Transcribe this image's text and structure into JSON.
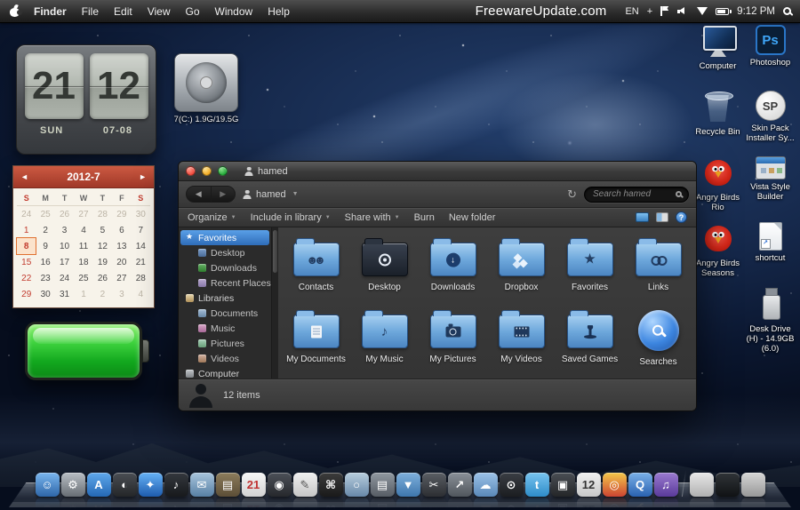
{
  "menubar": {
    "items": [
      "Finder",
      "File",
      "Edit",
      "View",
      "Go",
      "Window",
      "Help"
    ],
    "watermark": "FreewareUpdate.com",
    "lang": "EN",
    "plus": "+",
    "time": "9:12 PM"
  },
  "icons": {
    "back": "◀",
    "forward": "▶",
    "caret": "▼",
    "refresh": "↻",
    "help": "?",
    "prev": "◄",
    "next": "►",
    "apple": "apple-logo",
    "search": "magnifier",
    "wifi": "wifi",
    "volume": "speaker",
    "battery": "battery",
    "flag": "flag"
  },
  "widgets": {
    "flip_clock": {
      "hour": "21",
      "minute": "12",
      "weekday": "SUN",
      "date": "07-08"
    },
    "calendar": {
      "title": "2012-7",
      "day_headers": [
        "S",
        "M",
        "T",
        "W",
        "T",
        "F",
        "S"
      ],
      "weeks": [
        [
          {
            "d": "24",
            "m": 1
          },
          {
            "d": "25",
            "m": 1
          },
          {
            "d": "26",
            "m": 1
          },
          {
            "d": "27",
            "m": 1
          },
          {
            "d": "28",
            "m": 1
          },
          {
            "d": "29",
            "m": 1
          },
          {
            "d": "30",
            "m": 1
          }
        ],
        [
          {
            "d": "1",
            "r": 1
          },
          {
            "d": "2"
          },
          {
            "d": "3"
          },
          {
            "d": "4"
          },
          {
            "d": "5"
          },
          {
            "d": "6"
          },
          {
            "d": "7"
          }
        ],
        [
          {
            "d": "8",
            "r": 1,
            "s": 1
          },
          {
            "d": "9"
          },
          {
            "d": "10"
          },
          {
            "d": "11"
          },
          {
            "d": "12"
          },
          {
            "d": "13"
          },
          {
            "d": "14"
          }
        ],
        [
          {
            "d": "15",
            "r": 1
          },
          {
            "d": "16"
          },
          {
            "d": "17"
          },
          {
            "d": "18"
          },
          {
            "d": "19"
          },
          {
            "d": "20"
          },
          {
            "d": "21"
          }
        ],
        [
          {
            "d": "22",
            "r": 1
          },
          {
            "d": "23"
          },
          {
            "d": "24"
          },
          {
            "d": "25"
          },
          {
            "d": "26"
          },
          {
            "d": "27"
          },
          {
            "d": "28"
          }
        ],
        [
          {
            "d": "29",
            "r": 1
          },
          {
            "d": "30"
          },
          {
            "d": "31"
          },
          {
            "d": "1",
            "m": 1
          },
          {
            "d": "2",
            "m": 1
          },
          {
            "d": "3",
            "m": 1
          },
          {
            "d": "4",
            "m": 1
          }
        ]
      ]
    }
  },
  "desktop": {
    "drive": {
      "label": "7(C:) 1.9G/19.5G"
    },
    "right_icons": [
      {
        "label": "Computer",
        "icon": "computer"
      },
      {
        "label": "Photoshop",
        "icon": "photoshop",
        "glyph": "Ps"
      },
      {
        "label": "Recycle Bin",
        "icon": "recycle-bin"
      },
      {
        "label": "Skin Pack Installer Sy...",
        "icon": "skinpack",
        "glyph": "SP"
      },
      {
        "label": "Angry Birds Rio",
        "icon": "angry-bird"
      },
      {
        "label": "Vista Style Builder",
        "icon": "vsb"
      },
      {
        "label": "Angry Birds Seasons",
        "icon": "angry-bird"
      },
      {
        "label": "shortcut",
        "icon": "shortcut"
      },
      {
        "label": "Desk Drive (H) - 14.9GB (6.0)",
        "icon": "usb-drive",
        "col": 2
      }
    ]
  },
  "window": {
    "title": "hamed",
    "path": "hamed",
    "search_placeholder": "Search hamed",
    "commandbar": [
      {
        "label": "Organize",
        "dd": true
      },
      {
        "label": "Include in library",
        "dd": true
      },
      {
        "label": "Share with",
        "dd": true
      },
      {
        "label": "Burn"
      },
      {
        "label": "New folder"
      }
    ],
    "sidebar": {
      "sections": [
        {
          "label": "Favorites",
          "icon": "star",
          "selected": true,
          "items": [
            {
              "label": "Desktop",
              "icon": "desktop"
            },
            {
              "label": "Downloads",
              "icon": "downloads"
            },
            {
              "label": "Recent Places",
              "icon": "recent"
            }
          ]
        },
        {
          "label": "Libraries",
          "icon": "libraries",
          "items": [
            {
              "label": "Documents",
              "icon": "documents"
            },
            {
              "label": "Music",
              "icon": "music"
            },
            {
              "label": "Pictures",
              "icon": "pictures"
            },
            {
              "label": "Videos",
              "icon": "videos"
            }
          ]
        },
        {
          "label": "Computer",
          "icon": "computer",
          "items": []
        }
      ]
    },
    "folders": [
      {
        "label": "Contacts",
        "emblem": "contacts",
        "glyph": "☻☻"
      },
      {
        "label": "Desktop",
        "emblem": "desktop-logo",
        "variant": "dark"
      },
      {
        "label": "Downloads",
        "emblem": "downloads",
        "glyph": "↓"
      },
      {
        "label": "Dropbox",
        "emblem": "dropbox"
      },
      {
        "label": "Favorites",
        "emblem": "star",
        "glyph": "★"
      },
      {
        "label": "Links",
        "emblem": "links"
      },
      {
        "label": "My Documents",
        "emblem": "documents"
      },
      {
        "label": "My Music",
        "emblem": "music",
        "glyph": "♪"
      },
      {
        "label": "My Pictures",
        "emblem": "camera"
      },
      {
        "label": "My Videos",
        "emblem": "film"
      },
      {
        "label": "Saved Games",
        "emblem": "joystick"
      },
      {
        "label": "Searches",
        "emblem": "search",
        "variant": "sphere"
      }
    ],
    "status": "12 items"
  },
  "dock": {
    "icons": [
      {
        "name": "finder",
        "glyph": "☺",
        "c1": "#7ab6ef",
        "c2": "#2e66a8"
      },
      {
        "name": "system-preferences",
        "glyph": "⚙",
        "c1": "#b8bec4",
        "c2": "#686e74"
      },
      {
        "name": "app-store",
        "glyph": "A",
        "c1": "#5fa8ec",
        "c2": "#2468b4"
      },
      {
        "name": "dashboard",
        "glyph": "◐",
        "c1": "#4a4e54",
        "c2": "#242628"
      },
      {
        "name": "safari",
        "glyph": "✦",
        "c1": "#66b2f6",
        "c2": "#1e5cae"
      },
      {
        "name": "itunes-dj",
        "glyph": "♪",
        "c1": "#34383e",
        "c2": "#17191c"
      },
      {
        "name": "mail",
        "glyph": "✉",
        "c1": "#a9c5dd",
        "c2": "#5880a4"
      },
      {
        "name": "documents-folder",
        "glyph": "▤",
        "c1": "#8c7c5c",
        "c2": "#5c4e36"
      },
      {
        "name": "calendar",
        "glyph": "21",
        "c1": "#f6f6f6",
        "c2": "#d2d2d2",
        "fg": "#c03030"
      },
      {
        "name": "photo-booth",
        "glyph": "◉",
        "c1": "#4c5058",
        "c2": "#26282c"
      },
      {
        "name": "textedit",
        "glyph": "✎",
        "c1": "#efefef",
        "c2": "#c6c6c6",
        "fg": "#555555"
      },
      {
        "name": "terminal",
        "glyph": "⌘",
        "c1": "#3c3c3c",
        "c2": "#1a1a1a"
      },
      {
        "name": "preview",
        "glyph": "○",
        "c1": "#b8cede",
        "c2": "#6888a8"
      },
      {
        "name": "stacks",
        "glyph": "▤",
        "c1": "#9098a0",
        "c2": "#565c64"
      },
      {
        "name": "downloads-folder",
        "glyph": "▼",
        "c1": "#7fb0dc",
        "c2": "#3e76ac"
      },
      {
        "name": "utilities",
        "glyph": "✂",
        "c1": "#5a5e64",
        "c2": "#2c2e32"
      },
      {
        "name": "share",
        "glyph": "↗",
        "c1": "#8a9098",
        "c2": "#50565c"
      },
      {
        "name": "cloud",
        "glyph": "☁",
        "c1": "#9cc2e8",
        "c2": "#5a88b8"
      },
      {
        "name": "power",
        "glyph": "⊙",
        "c1": "#3a3e44",
        "c2": "#1b1d20"
      },
      {
        "name": "twitter",
        "glyph": "t",
        "c1": "#78c4f0",
        "c2": "#2e8cc8"
      },
      {
        "name": "camera",
        "glyph": "▣",
        "c1": "#4a4e54",
        "c2": "#242628"
      },
      {
        "name": "clock",
        "glyph": "12",
        "c1": "#f0f0f0",
        "c2": "#c8c8c8",
        "fg": "#333333"
      },
      {
        "name": "chrome",
        "glyph": "◎",
        "c1": "#f4c84a",
        "c2": "#cc4432"
      },
      {
        "name": "quicktime",
        "glyph": "Q",
        "c1": "#7ab0e8",
        "c2": "#2a62b0"
      },
      {
        "name": "itunes",
        "glyph": "♫",
        "c1": "#9a7ad0",
        "c2": "#5a3a9a"
      },
      {
        "name": "apple-software",
        "glyph": "",
        "c1": "#e8e8e8",
        "c2": "#b0b0b0",
        "sep": true
      },
      {
        "name": "iphone",
        "glyph": "",
        "c1": "#303438",
        "c2": "#101214"
      },
      {
        "name": "trash",
        "glyph": "",
        "c1": "#d6d6d6",
        "c2": "#989898"
      }
    ]
  }
}
